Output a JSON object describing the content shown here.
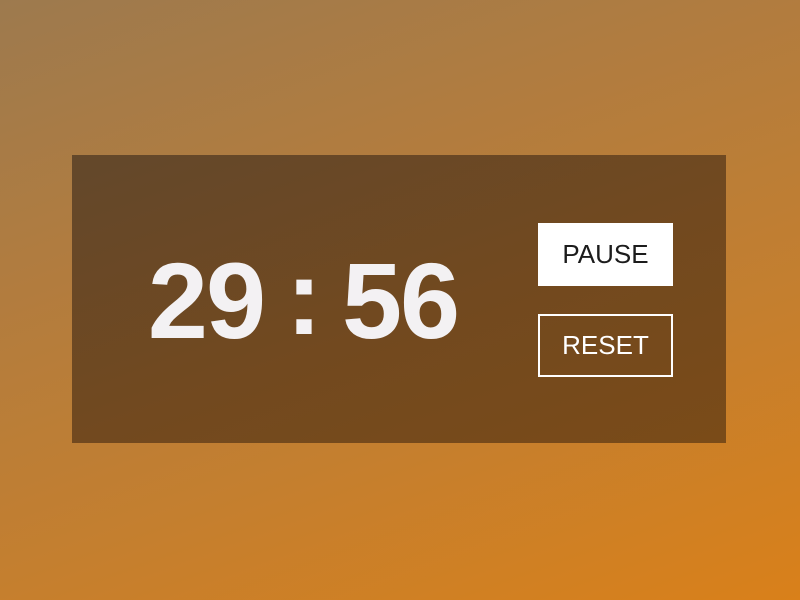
{
  "timer": {
    "minutes": "29",
    "separator": ":",
    "seconds": "56"
  },
  "controls": {
    "pause_label": "PAUSE",
    "reset_label": "RESET"
  },
  "colors": {
    "background_start": "#9d7a4e",
    "background_end": "#d9801a",
    "panel": "#6d4822",
    "digits": "#f3f1f3",
    "button_primary_bg": "#ffffff",
    "button_primary_text": "#1c1c1c",
    "button_outline": "#ffffff"
  }
}
